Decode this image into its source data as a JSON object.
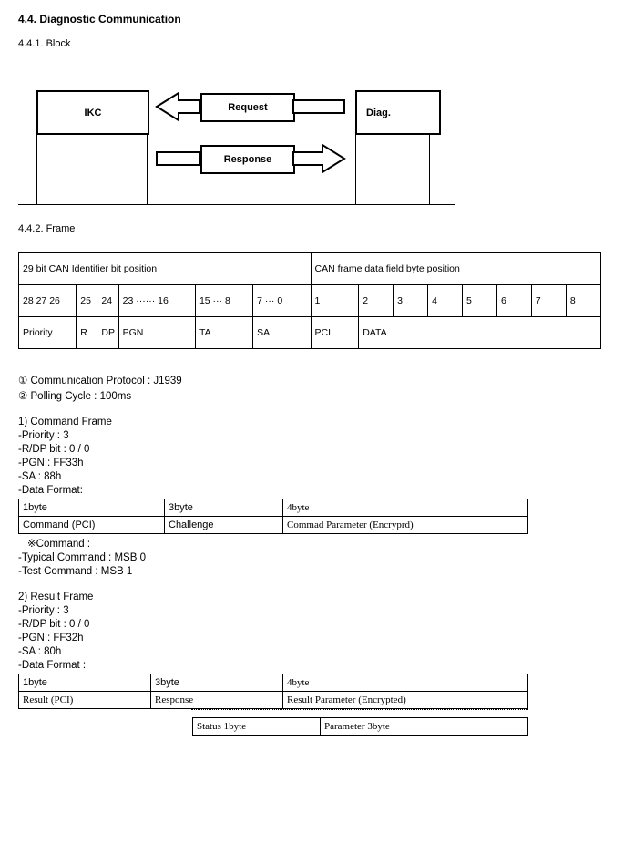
{
  "title": "4.4. Diagnostic Communication",
  "sub1": {
    "num": "4.4.1. Block"
  },
  "diagram": {
    "ikc": "IKC",
    "diag": "Diag.",
    "request": "Request",
    "response": "Response"
  },
  "sub2": {
    "num": "4.4.2. Frame"
  },
  "frameTable": {
    "hdrLeft": "29 bit CAN Identifier bit position",
    "hdrRight": "CAN frame data field byte position",
    "r2": {
      "c1": "28 27 26",
      "c2": "25",
      "c3": "24",
      "c4": "23 ······ 16",
      "c5": "15 ··· 8",
      "c6": "7 ··· 0",
      "c7": "1",
      "c8": "2",
      "c9": "3",
      "c10": "4",
      "c11": "5",
      "c12": "6",
      "c13": "7",
      "c14": "8"
    },
    "r3": {
      "c1": "Priority",
      "c2": "R",
      "c3": "DP",
      "c4": "PGN",
      "c5": "TA",
      "c6": "SA",
      "c7": "PCI",
      "c8": "DATA"
    }
  },
  "notes": {
    "n1": "①   Communication Protocol : J1939",
    "n2": "②   Polling Cycle : 100ms"
  },
  "cmdFrame": {
    "title": "1) Command Frame",
    "p1": "-Priority : 3",
    "p2": "-R/DP bit : 0 / 0",
    "p3": "-PGN : FF33h",
    "p4": "-SA : 88h",
    "p5": "-Data Format:",
    "t": {
      "h1": "1byte",
      "h2": "3byte",
      "h3": "4byte",
      "r1": "Command (PCI)",
      "r2": "Challenge",
      "r3": "Commad Parameter (Encryprd)"
    },
    "starCmd": "※Command :",
    "typ": "-Typical Command : MSB 0",
    "tst": "-Test Command : MSB 1"
  },
  "resFrame": {
    "title": "2) Result Frame",
    "p1": "-Priority : 3",
    "p2": "-R/DP bit : 0 / 0",
    "p3": "-PGN : FF32h",
    "p4": "-SA : 80h",
    "p5": "-Data Format :",
    "t": {
      "h1": "1byte",
      "h2": "3byte",
      "h3": "4byte",
      "r1": "Result (PCI)",
      "r2": "Response",
      "r3": "Result Parameter (Encrypted)"
    },
    "sub": {
      "c1": "Status 1byte",
      "c2": "Parameter 3byte"
    }
  }
}
